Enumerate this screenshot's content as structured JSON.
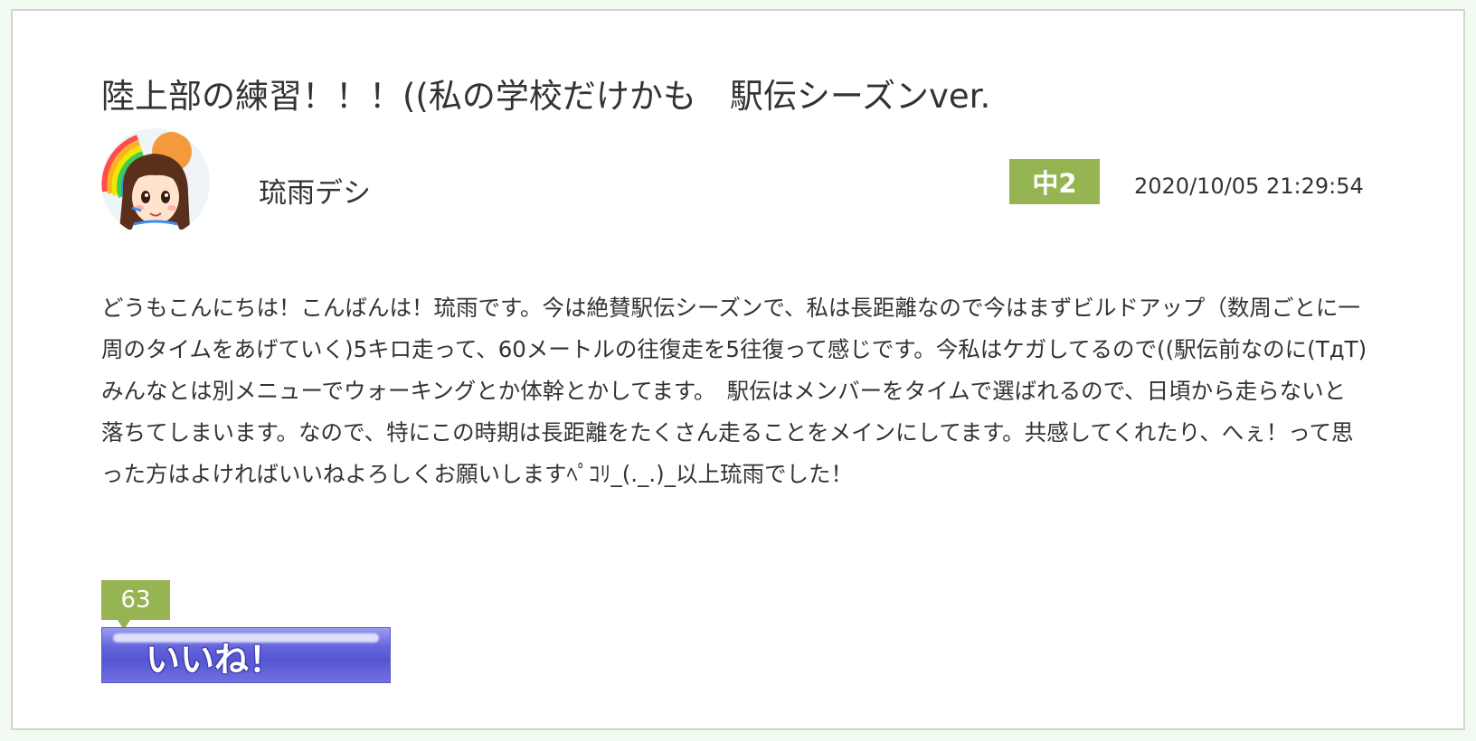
{
  "post": {
    "title": "陸上部の練習！！！((私の学校だけかも　駅伝シーズンver.",
    "author": "琉雨デシ",
    "grade": "中2",
    "timestamp": "2020/10/05 21:29:54",
    "body": "どうもこんにちは！こんばんは！琉雨です。今は絶賛駅伝シーズンで、私は長距離なので今はまずビルドアップ（数周ごとに一周のタイムをあげていく)5キロ走って、60メートルの往復走を5往復って感じです。今私はケガしてるので((駅伝前なのに(TдT)　みんなとは別メニューでウォーキングとか体幹とかしてます。　駅伝はメンバーをタイムで選ばれるので、日頃から走らないと落ちてしまいます。なので、特にこの時期は長距離をたくさん走ることをメインにしてます。共感してくれたり、へぇ！って思った方はよければいいねよろしくお願いしますﾍﾟｺﾘ_(._.)_以上琉雨でした！",
    "like_count": "63",
    "like_label": "いいね！"
  },
  "colors": {
    "page_background": "#f2fbf2",
    "badge_green": "#97b453",
    "like_button_blue": "#6565dc",
    "text": "#333333"
  },
  "icons": {
    "avatar": "girl-avatar-icon"
  }
}
